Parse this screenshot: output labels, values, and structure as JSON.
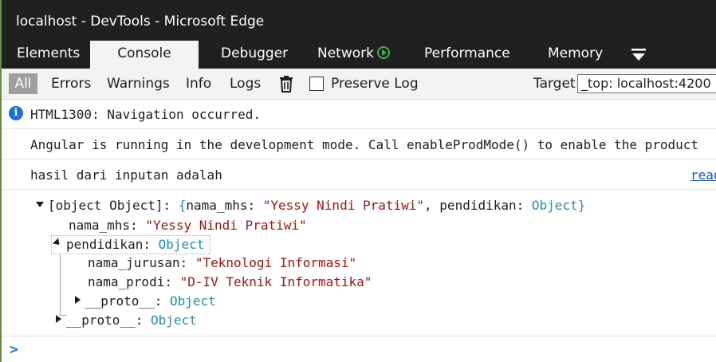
{
  "window": {
    "title": "localhost - DevTools - Microsoft Edge"
  },
  "tabs": [
    {
      "label": "Elements",
      "active": false
    },
    {
      "label": "Console",
      "active": true
    },
    {
      "label": "Debugger",
      "active": false
    },
    {
      "label": "Network",
      "active": false
    },
    {
      "label": "Performance",
      "active": false
    },
    {
      "label": "Memory",
      "active": false
    }
  ],
  "toolbar": {
    "filter_all": "All",
    "filter_errors": "Errors",
    "filter_warnings": "Warnings",
    "filter_info": "Info",
    "filter_logs": "Logs",
    "preserve_log_label": "Preserve Log",
    "preserve_log_checked": false,
    "target_label": "Target",
    "target_value": "_top: localhost:4200"
  },
  "console": {
    "messages": [
      {
        "icon": "info-icon",
        "text": "HTML1300: Navigation occurred."
      },
      {
        "text": "Angular is running in the development mode. Call enableProdMode() to enable the product"
      },
      {
        "text": "hasil dari inputan adalah",
        "source_link": "read"
      }
    ],
    "object_tree": {
      "root_label": "[object Object]: ",
      "root_open_brace": "{",
      "root_key1": "nama_mhs: ",
      "root_val1": "\"Yessy Nindi Pratiwi\"",
      "root_sep": ", ",
      "root_key2": "pendidikan: ",
      "root_val2": "Object",
      "root_close_brace": "}",
      "nama_mhs_key": "nama_mhs: ",
      "nama_mhs_value": "\"Yessy Nindi Pratiwi\"",
      "pendidikan_key": "pendidikan: ",
      "pendidikan_value": "Object",
      "nama_jurusan_key": "nama_jurusan: ",
      "nama_jurusan_value": "\"Teknologi Informasi\"",
      "nama_prodi_key": "nama_prodi: ",
      "nama_prodi_value": "\"D-IV Teknik Informatika\"",
      "inner_proto_key": "__proto__: ",
      "inner_proto_value": "Object",
      "outer_proto_key": "__proto__: ",
      "outer_proto_value": "Object"
    },
    "prompt_symbol": ">"
  },
  "colors": {
    "titlebar_bg": "#1f1f1f",
    "toolbar_bg": "#f3f3f3",
    "string_color": "#a31515",
    "object_color": "#2a8ca6",
    "info_blue": "#1e6fd9"
  }
}
